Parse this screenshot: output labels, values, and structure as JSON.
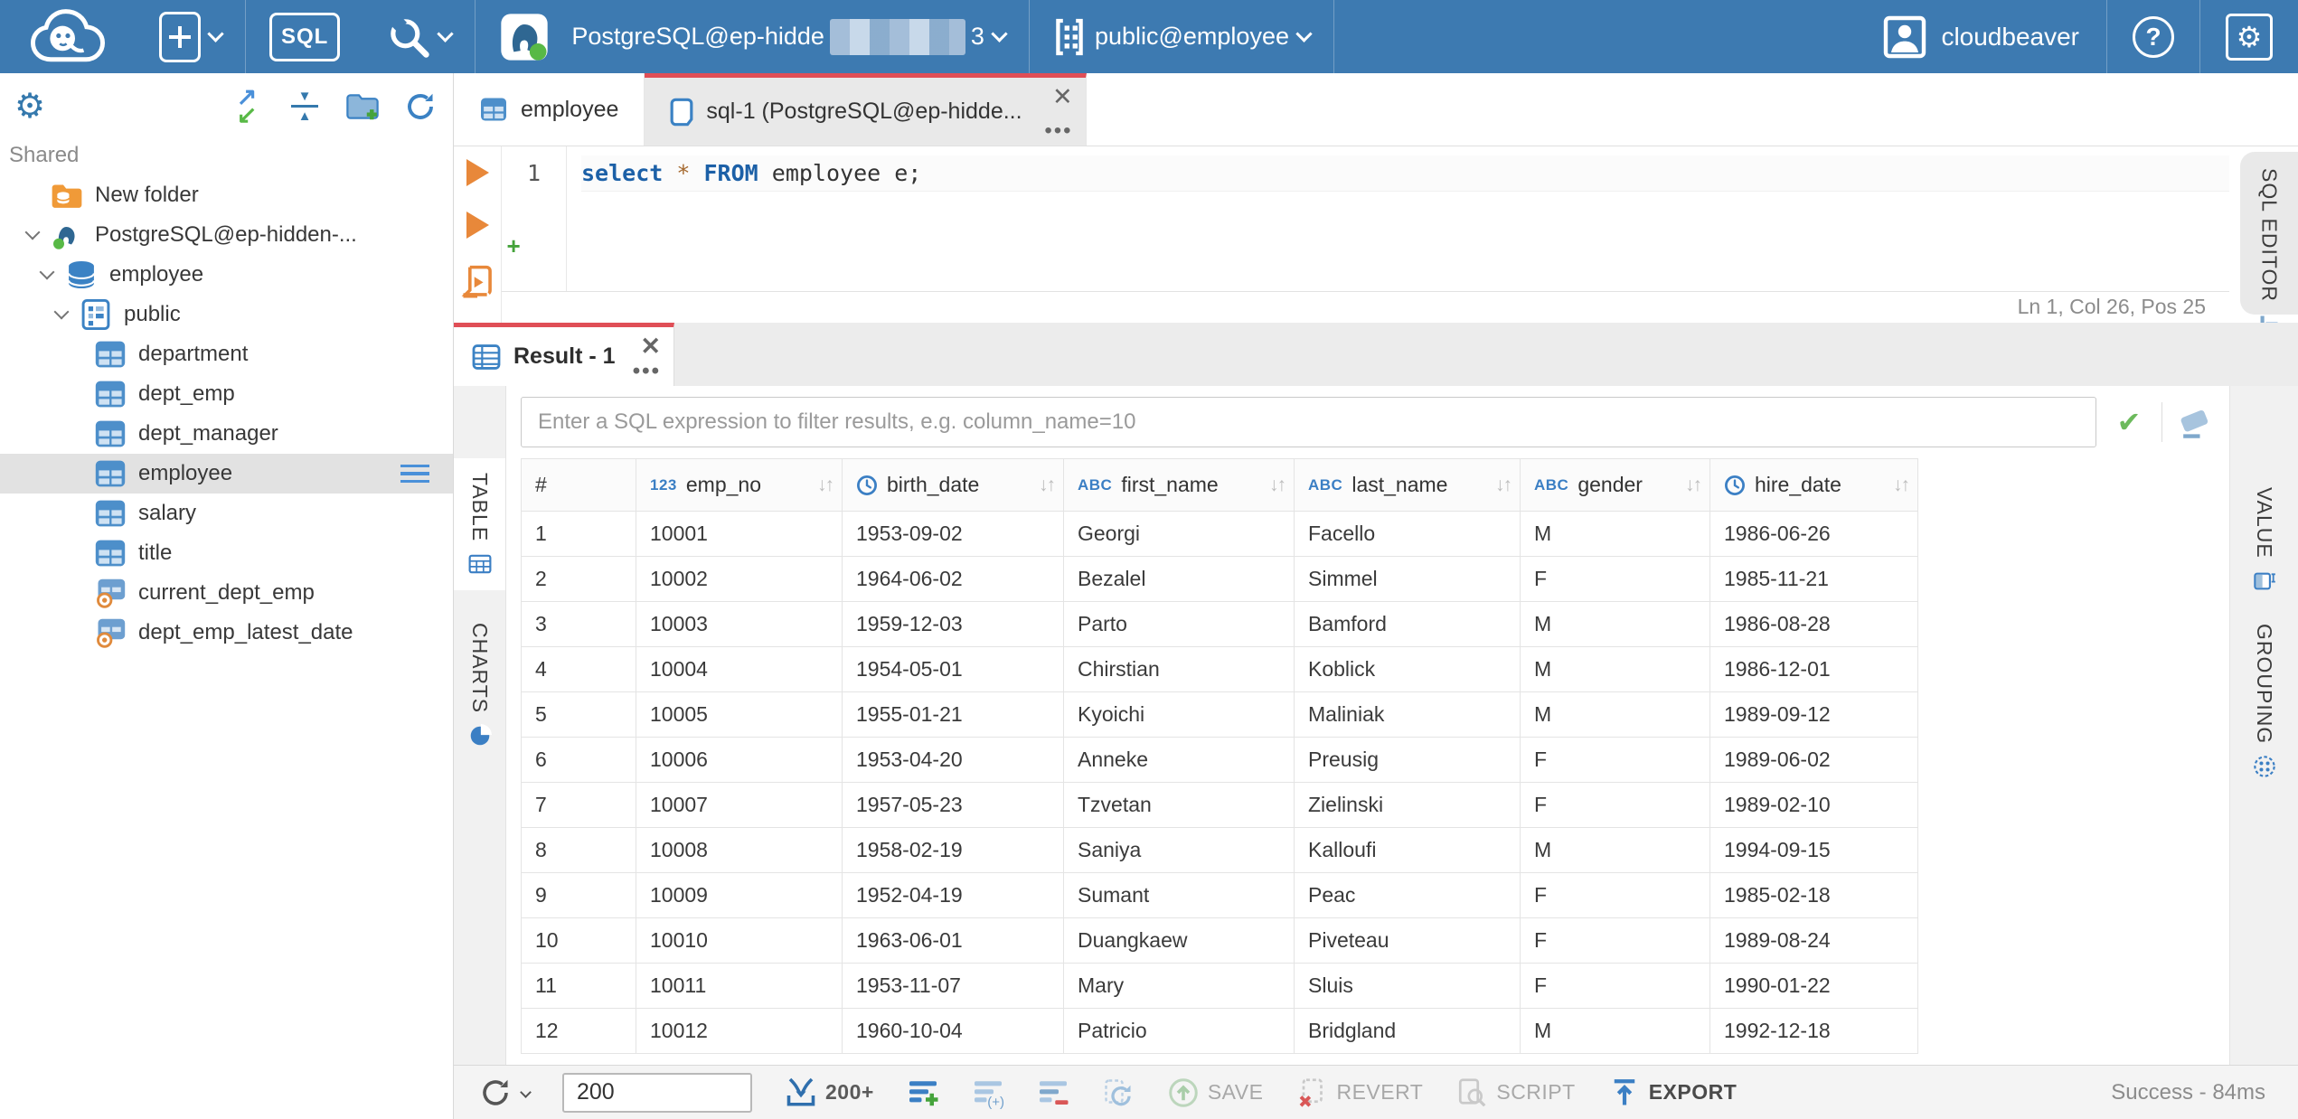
{
  "colors": {
    "topbar_blue": "#3d7ab1",
    "accent_red": "#e04e56",
    "icon_blue": "#3b7fc4",
    "green": "#52ae46",
    "orange": "#e8883a",
    "selection_gray": "#e2e2e2"
  },
  "topbar": {
    "connection": {
      "prefix": "PostgreSQL@ep-hidde",
      "suffix": "3"
    },
    "schema_selector": "public@employee",
    "user_label": "cloudbeaver"
  },
  "sidebar": {
    "section_label": "Shared",
    "tree": [
      {
        "label": "New folder",
        "icon": "folder-db",
        "level": 1,
        "chevron": false
      },
      {
        "label": "PostgreSQL@ep-hidden-...",
        "icon": "postgres",
        "level": 1,
        "chevron": true
      },
      {
        "label": "employee",
        "icon": "database",
        "level": 2,
        "chevron": true
      },
      {
        "label": "public",
        "icon": "schema",
        "level": 3,
        "chevron": true
      },
      {
        "label": "department",
        "icon": "table",
        "level": 4,
        "chevron": false
      },
      {
        "label": "dept_emp",
        "icon": "table",
        "level": 4,
        "chevron": false
      },
      {
        "label": "dept_manager",
        "icon": "table",
        "level": 4,
        "chevron": false
      },
      {
        "label": "employee",
        "icon": "table",
        "level": 4,
        "chevron": false,
        "selected": true
      },
      {
        "label": "salary",
        "icon": "table",
        "level": 4,
        "chevron": false
      },
      {
        "label": "title",
        "icon": "table",
        "level": 4,
        "chevron": false
      },
      {
        "label": "current_dept_emp",
        "icon": "view",
        "level": 4,
        "chevron": false
      },
      {
        "label": "dept_emp_latest_date",
        "icon": "view",
        "level": 4,
        "chevron": false
      }
    ]
  },
  "editor": {
    "tabs": [
      {
        "label": "employee"
      },
      {
        "label": "sql-1 (PostgreSQL@ep-hidde..."
      }
    ],
    "line_number": "1",
    "code_tokens": [
      {
        "text": "select",
        "type": "keyword"
      },
      {
        "text": " ",
        "type": "plain"
      },
      {
        "text": "*",
        "type": "operator"
      },
      {
        "text": " ",
        "type": "plain"
      },
      {
        "text": "FROM",
        "type": "keyword"
      },
      {
        "text": " employee e;",
        "type": "plain"
      }
    ],
    "status": "Ln 1, Col 26, Pos 25",
    "side_tab": "SQL EDITOR"
  },
  "result": {
    "tab_label": "Result - 1",
    "filter_placeholder": "Enter a SQL expression to filter results, e.g. column_name=10",
    "left_tabs": [
      {
        "label": "TABLE"
      },
      {
        "label": "CHARTS"
      }
    ],
    "right_tabs": [
      {
        "label": "VALUE"
      },
      {
        "label": "GROUPING"
      }
    ],
    "grid": {
      "row_header": "#",
      "columns": [
        {
          "name": "emp_no",
          "type": "number"
        },
        {
          "name": "birth_date",
          "type": "date"
        },
        {
          "name": "first_name",
          "type": "string"
        },
        {
          "name": "last_name",
          "type": "string"
        },
        {
          "name": "gender",
          "type": "string"
        },
        {
          "name": "hire_date",
          "type": "date"
        }
      ],
      "rows": [
        [
          "1",
          "10001",
          "1953-09-02",
          "Georgi",
          "Facello",
          "M",
          "1986-06-26"
        ],
        [
          "2",
          "10002",
          "1964-06-02",
          "Bezalel",
          "Simmel",
          "F",
          "1985-11-21"
        ],
        [
          "3",
          "10003",
          "1959-12-03",
          "Parto",
          "Bamford",
          "M",
          "1986-08-28"
        ],
        [
          "4",
          "10004",
          "1954-05-01",
          "Chirstian",
          "Koblick",
          "M",
          "1986-12-01"
        ],
        [
          "5",
          "10005",
          "1955-01-21",
          "Kyoichi",
          "Maliniak",
          "M",
          "1989-09-12"
        ],
        [
          "6",
          "10006",
          "1953-04-20",
          "Anneke",
          "Preusig",
          "F",
          "1989-06-02"
        ],
        [
          "7",
          "10007",
          "1957-05-23",
          "Tzvetan",
          "Zielinski",
          "F",
          "1989-02-10"
        ],
        [
          "8",
          "10008",
          "1958-02-19",
          "Saniya",
          "Kalloufi",
          "M",
          "1994-09-15"
        ],
        [
          "9",
          "10009",
          "1952-04-19",
          "Sumant",
          "Peac",
          "F",
          "1985-02-18"
        ],
        [
          "10",
          "10010",
          "1963-06-01",
          "Duangkaew",
          "Piveteau",
          "F",
          "1989-08-24"
        ],
        [
          "11",
          "10011",
          "1953-11-07",
          "Mary",
          "Sluis",
          "F",
          "1990-01-22"
        ],
        [
          "12",
          "10012",
          "1960-10-04",
          "Patricio",
          "Bridgland",
          "M",
          "1992-12-18"
        ]
      ]
    },
    "toolbar": {
      "rows_limit": "200",
      "fetch_label": "200+",
      "save_label": "SAVE",
      "revert_label": "REVERT",
      "script_label": "SCRIPT",
      "export_label": "EXPORT",
      "status": "Success - 84ms"
    }
  }
}
